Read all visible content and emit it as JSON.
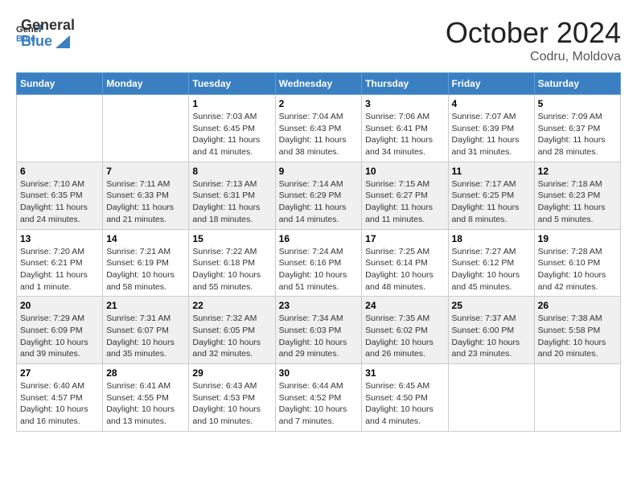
{
  "header": {
    "logo_general": "General",
    "logo_blue": "Blue",
    "month_title": "October 2024",
    "location": "Codru, Moldova"
  },
  "weekdays": [
    "Sunday",
    "Monday",
    "Tuesday",
    "Wednesday",
    "Thursday",
    "Friday",
    "Saturday"
  ],
  "weeks": [
    [
      {
        "day": "",
        "sunrise": "",
        "sunset": "",
        "daylight": ""
      },
      {
        "day": "",
        "sunrise": "",
        "sunset": "",
        "daylight": ""
      },
      {
        "day": "1",
        "sunrise": "Sunrise: 7:03 AM",
        "sunset": "Sunset: 6:45 PM",
        "daylight": "Daylight: 11 hours and 41 minutes."
      },
      {
        "day": "2",
        "sunrise": "Sunrise: 7:04 AM",
        "sunset": "Sunset: 6:43 PM",
        "daylight": "Daylight: 11 hours and 38 minutes."
      },
      {
        "day": "3",
        "sunrise": "Sunrise: 7:06 AM",
        "sunset": "Sunset: 6:41 PM",
        "daylight": "Daylight: 11 hours and 34 minutes."
      },
      {
        "day": "4",
        "sunrise": "Sunrise: 7:07 AM",
        "sunset": "Sunset: 6:39 PM",
        "daylight": "Daylight: 11 hours and 31 minutes."
      },
      {
        "day": "5",
        "sunrise": "Sunrise: 7:09 AM",
        "sunset": "Sunset: 6:37 PM",
        "daylight": "Daylight: 11 hours and 28 minutes."
      }
    ],
    [
      {
        "day": "6",
        "sunrise": "Sunrise: 7:10 AM",
        "sunset": "Sunset: 6:35 PM",
        "daylight": "Daylight: 11 hours and 24 minutes."
      },
      {
        "day": "7",
        "sunrise": "Sunrise: 7:11 AM",
        "sunset": "Sunset: 6:33 PM",
        "daylight": "Daylight: 11 hours and 21 minutes."
      },
      {
        "day": "8",
        "sunrise": "Sunrise: 7:13 AM",
        "sunset": "Sunset: 6:31 PM",
        "daylight": "Daylight: 11 hours and 18 minutes."
      },
      {
        "day": "9",
        "sunrise": "Sunrise: 7:14 AM",
        "sunset": "Sunset: 6:29 PM",
        "daylight": "Daylight: 11 hours and 14 minutes."
      },
      {
        "day": "10",
        "sunrise": "Sunrise: 7:15 AM",
        "sunset": "Sunset: 6:27 PM",
        "daylight": "Daylight: 11 hours and 11 minutes."
      },
      {
        "day": "11",
        "sunrise": "Sunrise: 7:17 AM",
        "sunset": "Sunset: 6:25 PM",
        "daylight": "Daylight: 11 hours and 8 minutes."
      },
      {
        "day": "12",
        "sunrise": "Sunrise: 7:18 AM",
        "sunset": "Sunset: 6:23 PM",
        "daylight": "Daylight: 11 hours and 5 minutes."
      }
    ],
    [
      {
        "day": "13",
        "sunrise": "Sunrise: 7:20 AM",
        "sunset": "Sunset: 6:21 PM",
        "daylight": "Daylight: 11 hours and 1 minute."
      },
      {
        "day": "14",
        "sunrise": "Sunrise: 7:21 AM",
        "sunset": "Sunset: 6:19 PM",
        "daylight": "Daylight: 10 hours and 58 minutes."
      },
      {
        "day": "15",
        "sunrise": "Sunrise: 7:22 AM",
        "sunset": "Sunset: 6:18 PM",
        "daylight": "Daylight: 10 hours and 55 minutes."
      },
      {
        "day": "16",
        "sunrise": "Sunrise: 7:24 AM",
        "sunset": "Sunset: 6:16 PM",
        "daylight": "Daylight: 10 hours and 51 minutes."
      },
      {
        "day": "17",
        "sunrise": "Sunrise: 7:25 AM",
        "sunset": "Sunset: 6:14 PM",
        "daylight": "Daylight: 10 hours and 48 minutes."
      },
      {
        "day": "18",
        "sunrise": "Sunrise: 7:27 AM",
        "sunset": "Sunset: 6:12 PM",
        "daylight": "Daylight: 10 hours and 45 minutes."
      },
      {
        "day": "19",
        "sunrise": "Sunrise: 7:28 AM",
        "sunset": "Sunset: 6:10 PM",
        "daylight": "Daylight: 10 hours and 42 minutes."
      }
    ],
    [
      {
        "day": "20",
        "sunrise": "Sunrise: 7:29 AM",
        "sunset": "Sunset: 6:09 PM",
        "daylight": "Daylight: 10 hours and 39 minutes."
      },
      {
        "day": "21",
        "sunrise": "Sunrise: 7:31 AM",
        "sunset": "Sunset: 6:07 PM",
        "daylight": "Daylight: 10 hours and 35 minutes."
      },
      {
        "day": "22",
        "sunrise": "Sunrise: 7:32 AM",
        "sunset": "Sunset: 6:05 PM",
        "daylight": "Daylight: 10 hours and 32 minutes."
      },
      {
        "day": "23",
        "sunrise": "Sunrise: 7:34 AM",
        "sunset": "Sunset: 6:03 PM",
        "daylight": "Daylight: 10 hours and 29 minutes."
      },
      {
        "day": "24",
        "sunrise": "Sunrise: 7:35 AM",
        "sunset": "Sunset: 6:02 PM",
        "daylight": "Daylight: 10 hours and 26 minutes."
      },
      {
        "day": "25",
        "sunrise": "Sunrise: 7:37 AM",
        "sunset": "Sunset: 6:00 PM",
        "daylight": "Daylight: 10 hours and 23 minutes."
      },
      {
        "day": "26",
        "sunrise": "Sunrise: 7:38 AM",
        "sunset": "Sunset: 5:58 PM",
        "daylight": "Daylight: 10 hours and 20 minutes."
      }
    ],
    [
      {
        "day": "27",
        "sunrise": "Sunrise: 6:40 AM",
        "sunset": "Sunset: 4:57 PM",
        "daylight": "Daylight: 10 hours and 16 minutes."
      },
      {
        "day": "28",
        "sunrise": "Sunrise: 6:41 AM",
        "sunset": "Sunset: 4:55 PM",
        "daylight": "Daylight: 10 hours and 13 minutes."
      },
      {
        "day": "29",
        "sunrise": "Sunrise: 6:43 AM",
        "sunset": "Sunset: 4:53 PM",
        "daylight": "Daylight: 10 hours and 10 minutes."
      },
      {
        "day": "30",
        "sunrise": "Sunrise: 6:44 AM",
        "sunset": "Sunset: 4:52 PM",
        "daylight": "Daylight: 10 hours and 7 minutes."
      },
      {
        "day": "31",
        "sunrise": "Sunrise: 6:45 AM",
        "sunset": "Sunset: 4:50 PM",
        "daylight": "Daylight: 10 hours and 4 minutes."
      },
      {
        "day": "",
        "sunrise": "",
        "sunset": "",
        "daylight": ""
      },
      {
        "day": "",
        "sunrise": "",
        "sunset": "",
        "daylight": ""
      }
    ]
  ]
}
